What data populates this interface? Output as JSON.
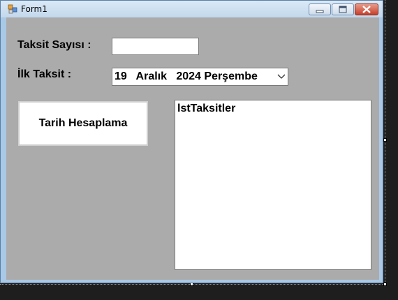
{
  "window": {
    "title": "Form1"
  },
  "form": {
    "taksit_label": "Taksit Sayısı :",
    "taksit_value": "",
    "ilk_taksit_label": "İlk Taksit :",
    "date_value": "19   Aralık   2024 Perşembe",
    "calc_button_label": "Tarih Hesaplama",
    "listbox_item": "lstTaksitler"
  },
  "icons": {
    "app": "form-app-icon",
    "minimize": "minimize-icon",
    "maximize": "maximize-icon",
    "close": "close-icon",
    "dropdown": "chevron-down-icon"
  },
  "colors": {
    "client_background": "#ababab",
    "titlebar": "#c3d8ec",
    "close_button": "#c6402b"
  }
}
